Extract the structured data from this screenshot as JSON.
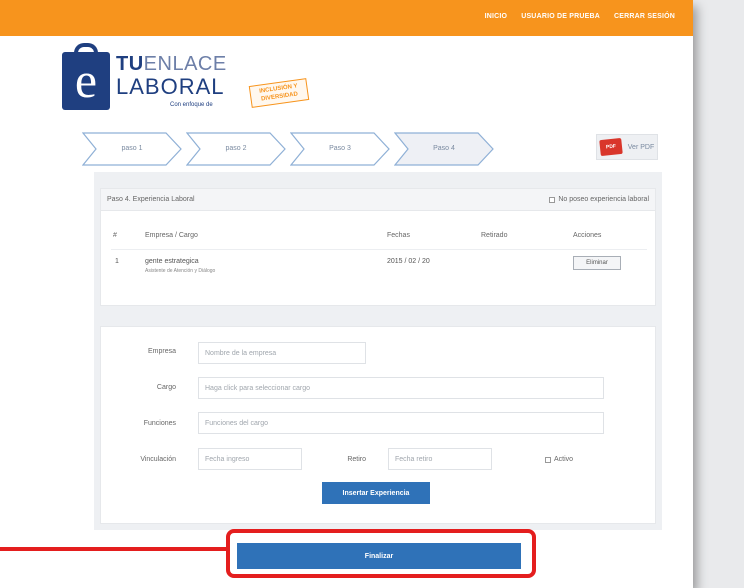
{
  "colors": {
    "topbar": "#f7941d",
    "brand_blue": "#1f3f80",
    "button_blue": "#2f72b8",
    "highlight_red": "#e41e1e"
  },
  "topnav": [
    "INICIO",
    "USUARIO DE PRUEBA",
    "CERRAR SESIÓN"
  ],
  "logo": {
    "line1_bold": "TU",
    "line1_light": "ENLACE",
    "line2": "LABORAL",
    "line3": "Con enfoque de",
    "stamp": "INCLUSIÓN Y DIVERSIDAD"
  },
  "steps": [
    {
      "label": "paso 1"
    },
    {
      "label": "paso 2"
    },
    {
      "label": "Paso 3"
    },
    {
      "label": "Paso 4",
      "active": true
    }
  ],
  "pdf_button": {
    "icon": "pdf-icon",
    "label": "Ver PDF"
  },
  "experience": {
    "title": "Paso 4. Experiencia Laboral",
    "no_experience_label": "No poseo experiencia laboral",
    "columns": [
      "#",
      "Empresa / Cargo",
      "Fechas",
      "Retirado",
      "Acciones"
    ],
    "rows": [
      {
        "num": "1",
        "company": "gente estrategica",
        "position": "Asistente de Atención y Diálogo",
        "dates": "2015 / 02 / 20",
        "retired": "",
        "action": "Eliminar"
      }
    ]
  },
  "form": {
    "company_label": "Empresa",
    "company_placeholder": "Nombre de la empresa",
    "position_label": "Cargo",
    "position_placeholder": "Haga click para seleccionar cargo",
    "functions_label": "Funciones",
    "functions_placeholder": "Funciones del cargo",
    "link_label": "Vinculación",
    "link_placeholder": "Fecha ingreso",
    "retire_label": "Retiro",
    "retire_placeholder": "Fecha retiro",
    "active_label": "Activo",
    "save_button": "Insertar Experiencia"
  },
  "finish_button": "Finalizar"
}
